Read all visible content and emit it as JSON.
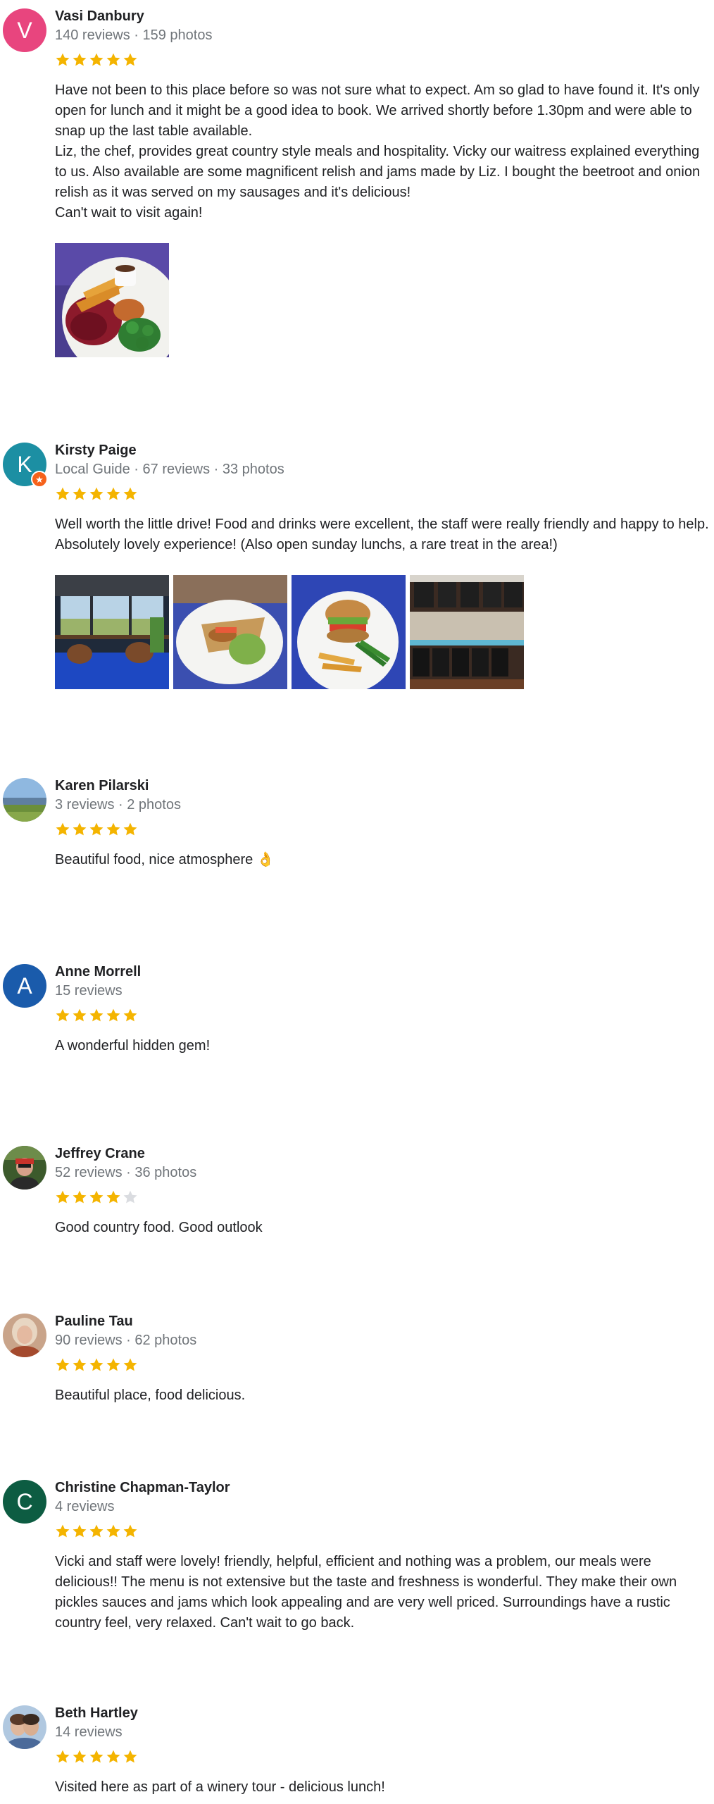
{
  "colors": {
    "star_filled": "#f4b400",
    "star_empty": "#dadce0",
    "meta_gray": "#70757a"
  },
  "reviews": [
    {
      "name": "Vasi Danbury",
      "meta": "140 reviews · 159 photos",
      "rating": 5,
      "avatar_letter": "V",
      "avatar_color": "#e8457e",
      "text": "Have not been to this place before so was not sure what to expect.  Am so glad to have found it.  It's only open for lunch and it might be a good idea to book.  We arrived shortly before 1.30pm and were able to snap up the last table available.\nLiz,  the chef,  provides great country style meals and hospitality.  Vicky our waitress explained everything to us.  Also available are some magnificent relish and jams  made by Liz. I bought the beetroot and onion relish as it was served on my sausages and it's delicious!\nCan't wait to visit again!",
      "photos": [
        "food-plate-photo"
      ]
    },
    {
      "name": "Kirsty Paige",
      "meta": "Local Guide · 67 reviews · 33 photos",
      "rating": 5,
      "avatar_letter": "K",
      "avatar_color": "#1c8fa3",
      "text": "Well worth the little drive! Food and drinks were excellent, the staff were really friendly and happy to help. Absolutely lovely experience! (Also open sunday lunchs, a rare treat in the area!)",
      "photos": [
        "dining-room-photo",
        "burger-plate-photo",
        "burger-fries-photo",
        "bar-counter-photo"
      ]
    },
    {
      "name": "Karen Pilarski",
      "meta": "3 reviews · 2 photos",
      "rating": 5,
      "text": "Beautiful  food, nice atmosphere 👌"
    },
    {
      "name": "Anne Morrell",
      "meta": "15 reviews",
      "rating": 5,
      "avatar_letter": "A",
      "avatar_color": "#1a5bab",
      "text": "A wonderful hidden gem!"
    },
    {
      "name": "Jeffrey Crane",
      "meta": "52 reviews · 36 photos",
      "rating": 4,
      "text": "Good country food. Good outlook"
    },
    {
      "name": "Pauline Tau",
      "meta": "90 reviews · 62 photos",
      "rating": 5,
      "text": "Beautiful place, food delicious."
    },
    {
      "name": "Christine Chapman-Taylor",
      "meta": "4 reviews",
      "rating": 5,
      "avatar_letter": "C",
      "avatar_color": "#0d5c42",
      "text": "Vicki and staff were lovely! friendly, helpful, efficient and nothing was a problem, our meals were delicious!! The menu is not extensive but the taste and freshness is wonderful. They make their own pickles  sauces and jams which look appealing and are very well priced. Surroundings have a rustic country feel, very relaxed. Can't wait to go back."
    },
    {
      "name": "Beth Hartley",
      "meta": "14 reviews",
      "rating": 5,
      "text": "Visited here as part of a winery tour - delicious lunch!"
    }
  ]
}
